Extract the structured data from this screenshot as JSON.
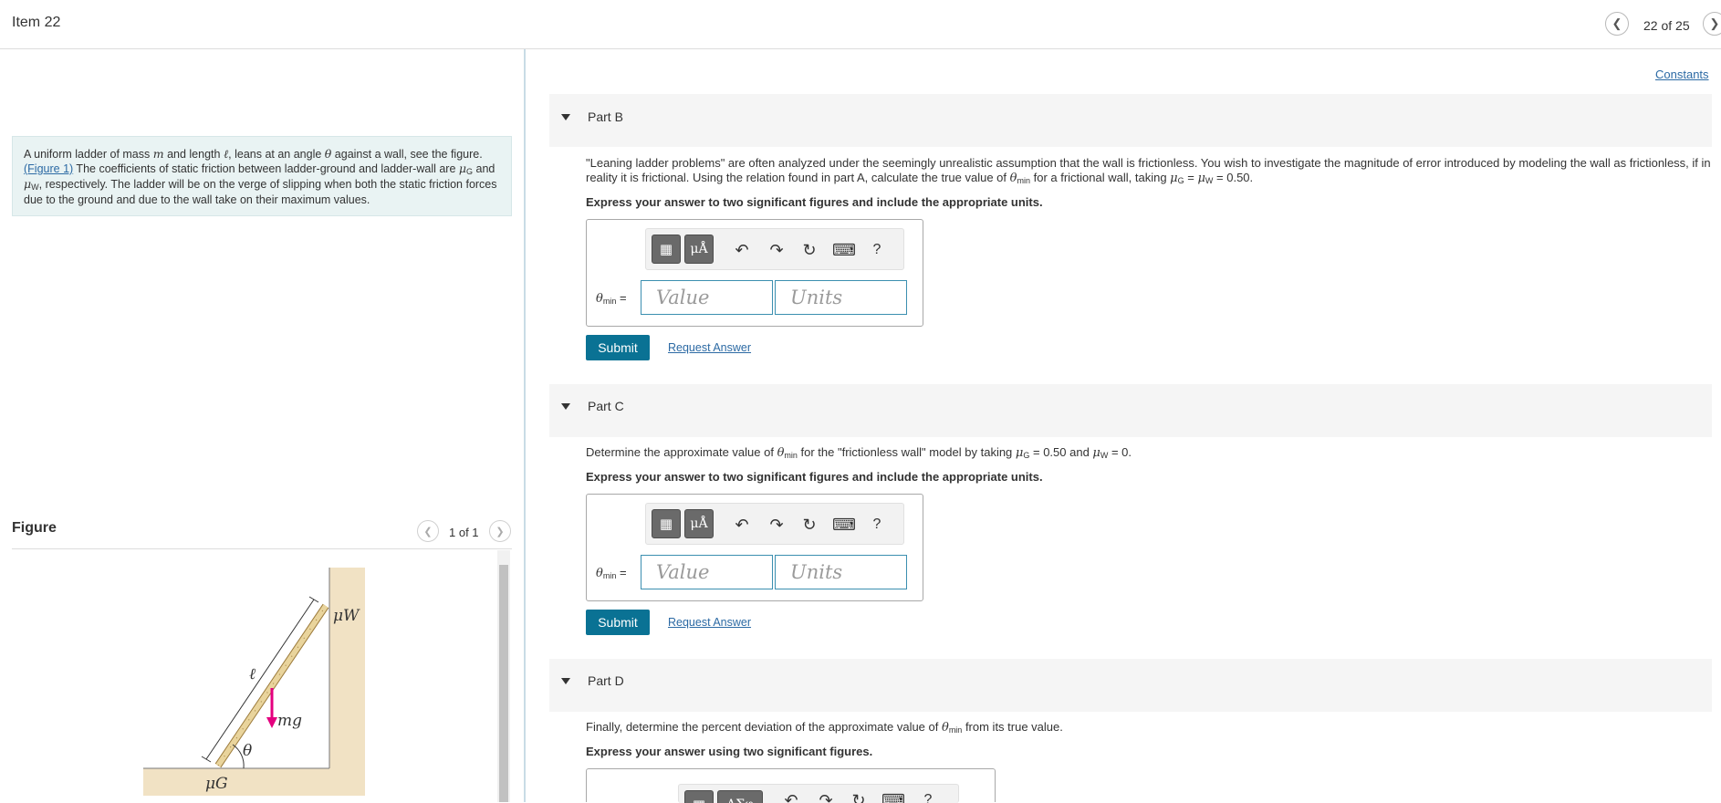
{
  "header": {
    "item_title": "Item 22",
    "page_count": "22 of 25"
  },
  "intro": {
    "t1": "A uniform ladder of mass ",
    "m": "m",
    "t2": " and length ",
    "ell": "ℓ",
    "t3": ", leans at an angle ",
    "theta": "θ",
    "t4": " against a wall, see the figure.",
    "figure_link": "(Figure 1)",
    "t5": " The coefficients of static friction between ladder-ground and ladder-wall are ",
    "mu": "μ",
    "g_sub": "G",
    "t6": " and ",
    "w_sub": "W",
    "t7": ", respectively. The ladder will be on the verge of slipping when both the static friction forces due to the ground and due to the wall take on their maximum values."
  },
  "figure": {
    "label": "Figure",
    "count": "1 of 1",
    "labels": {
      "mu_w": "μW",
      "ell": "ℓ",
      "mg": "mg",
      "theta": "θ",
      "mu_g": "μG"
    },
    "colors": {
      "wall": "#f1e2c4",
      "ladder": "#e9d49c",
      "force_arrow": "#e4007f"
    }
  },
  "constants_link": "Constants",
  "toolbar": {
    "symbols_label": "μÅ",
    "help_label": "?",
    "part_d_symbols_label": "ΑΣφ"
  },
  "parts": [
    {
      "title": "Part B",
      "text1": "\"Leaning ladder problems\" are often analyzed under the seemingly unrealistic assumption that the wall is frictionless. You wish to investigate the magnitude of error introduced by modeling the wall as frictionless, if in",
      "text2a": "reality it is frictional. Using the relation found in part A, calculate the true value of ",
      "text2b": " for a frictional wall, taking ",
      "text2c": "μ",
      "text2d": "G",
      "text2e": " = ",
      "text2f": "μ",
      "text2g": "W",
      "text2h": " = 0.50.",
      "instruction": "Express your answer to two significant figures and include the appropriate units.",
      "variable": "θ",
      "variable_sub": "min",
      "equals": " =",
      "value_placeholder": "Value",
      "units_placeholder": "Units",
      "submit": "Submit",
      "request": "Request Answer"
    },
    {
      "title": "Part C",
      "text1a": "Determine the approximate value of ",
      "text1b": " for the \"frictionless wall\" model by taking ",
      "text1c": "μ",
      "text1d": "G",
      "text1e": " = 0.50 and ",
      "text1f": "μ",
      "text1g": "W",
      "text1h": " = 0.",
      "instruction": "Express your answer to two significant figures and include the appropriate units.",
      "variable": "θ",
      "variable_sub": "min",
      "equals": " =",
      "value_placeholder": "Value",
      "units_placeholder": "Units",
      "submit": "Submit",
      "request": "Request Answer"
    },
    {
      "title": "Part D",
      "text1a": "Finally, determine the percent deviation of the approximate value of ",
      "text1b": " from its true value.",
      "instruction": "Express your answer using two significant figures."
    }
  ]
}
